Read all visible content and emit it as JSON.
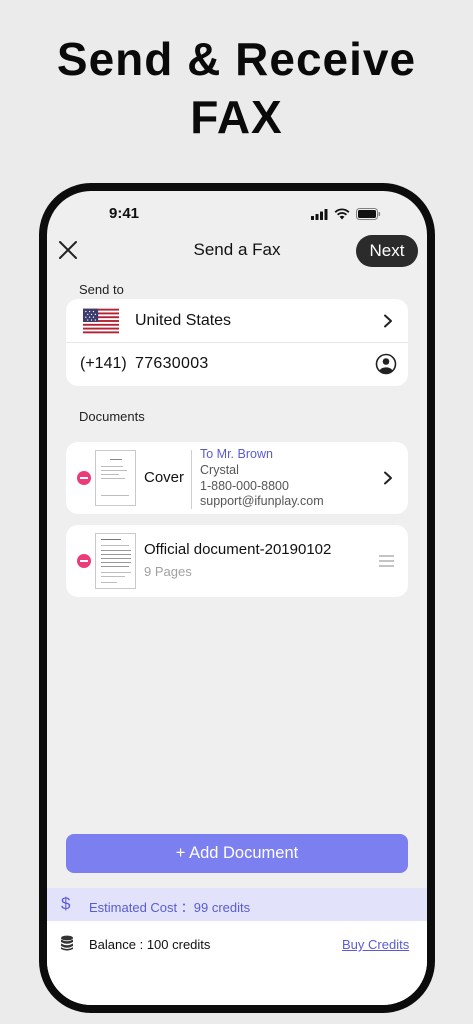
{
  "headline": {
    "line1": "Send & Receive",
    "line2": "FAX"
  },
  "status_bar": {
    "time": "9:41"
  },
  "nav": {
    "title": "Send a Fax",
    "next_label": "Next"
  },
  "send_to": {
    "label": "Send to",
    "country": "United States",
    "country_code": "(+141)",
    "number": "77630003"
  },
  "documents": {
    "label": "Documents",
    "cover": {
      "label": "Cover",
      "to": "To Mr. Brown",
      "name": "Crystal",
      "phone": "1-880-000-8800",
      "email": "support@ifunplay.com"
    },
    "files": [
      {
        "title": "Official document-20190102",
        "pages": "9 Pages"
      }
    ]
  },
  "actions": {
    "add_document": "+ Add Document"
  },
  "cost": {
    "icon_glyph": "$",
    "label": "Estimated Cost ：99 credits"
  },
  "balance": {
    "label": "Balance : 100 credits",
    "buy_label": "Buy Credits"
  },
  "colors": {
    "accent": "#5a5bd3",
    "add_button": "#7b7ff0",
    "remove": "#ec3b79",
    "cost_bar": "#e2e3fb"
  }
}
